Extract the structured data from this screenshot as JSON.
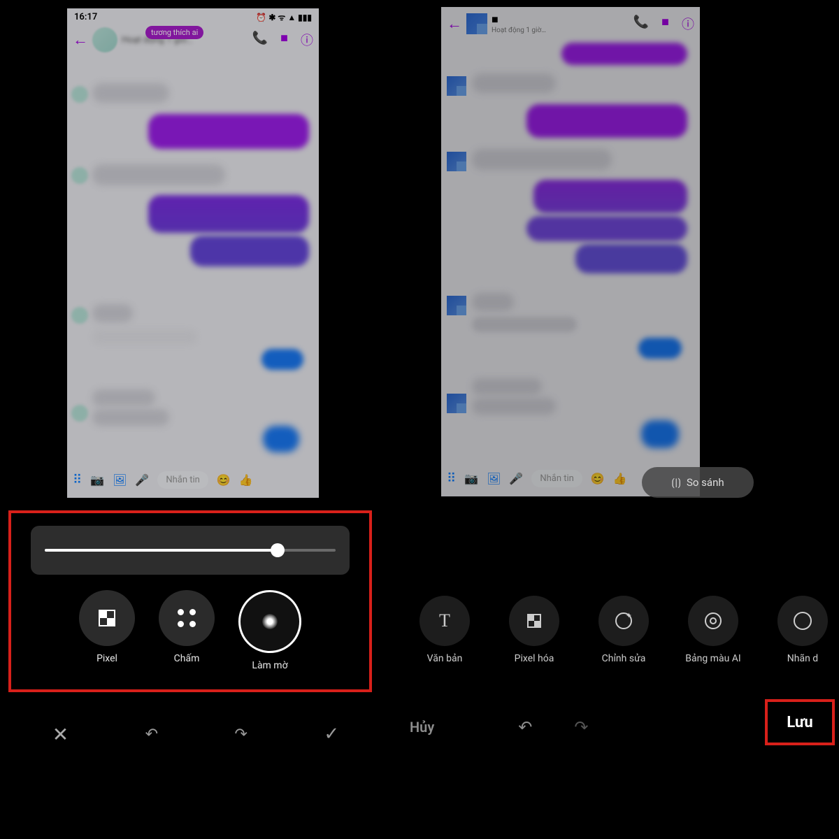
{
  "left_phone": {
    "time": "16:17",
    "status_text": "Hoạt động 1 giờ…",
    "tag": "tương thích ai",
    "input_placeholder": "Nhắn tin"
  },
  "right_phone": {
    "activity": "Hoạt động 1 giờ…",
    "input_placeholder": "Nhắn tin"
  },
  "compare": {
    "label": "So sánh"
  },
  "blur_panel": {
    "slider_percent": 80,
    "tools": {
      "pixel": "Pixel",
      "dot": "Chấm",
      "blur": "Làm mờ"
    }
  },
  "strip": {
    "text": "Văn bản",
    "pixelate": "Pixel hóa",
    "edit": "Chỉnh sửa",
    "palette": "Bảng màu AI",
    "sticker": "Nhãn d"
  },
  "footer": {
    "cancel": "Hủy",
    "save": "Lưu"
  }
}
